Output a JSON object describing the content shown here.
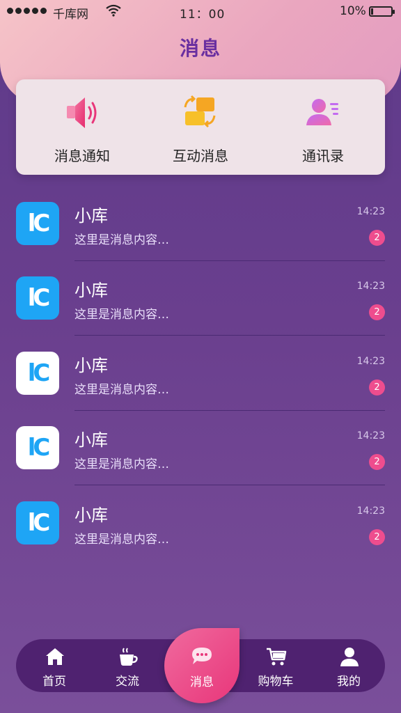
{
  "status_bar": {
    "carrier": "千库网",
    "time": "11：00",
    "battery": "10%",
    "battery_level": 0.1
  },
  "header": {
    "title": "消息"
  },
  "quick_actions": [
    {
      "label": "消息通知",
      "icon": "speaker-icon"
    },
    {
      "label": "互动消息",
      "icon": "interaction-icon"
    },
    {
      "label": "通讯录",
      "icon": "contacts-icon"
    }
  ],
  "messages": [
    {
      "name": "小库",
      "preview": "这里是消息内容…",
      "time": "14:23",
      "badge": "2",
      "avatar_style": "blue"
    },
    {
      "name": "小库",
      "preview": "这里是消息内容…",
      "time": "14:23",
      "badge": "2",
      "avatar_style": "blue"
    },
    {
      "name": "小库",
      "preview": "这里是消息内容…",
      "time": "14:23",
      "badge": "2",
      "avatar_style": "white"
    },
    {
      "name": "小库",
      "preview": "这里是消息内容…",
      "time": "14:23",
      "badge": "2",
      "avatar_style": "white"
    },
    {
      "name": "小库",
      "preview": "这里是消息内容…",
      "time": "14:23",
      "badge": "2",
      "avatar_style": "blue"
    }
  ],
  "tabbar": {
    "items": [
      {
        "label": "首页",
        "icon": "home-icon"
      },
      {
        "label": "交流",
        "icon": "coffee-icon"
      },
      {
        "label": "消息",
        "icon": "chat-bubble-icon",
        "active": true
      },
      {
        "label": "购物车",
        "icon": "cart-icon"
      },
      {
        "label": "我的",
        "icon": "user-icon"
      }
    ]
  },
  "colors": {
    "accent": "#ee4d8e",
    "title": "#6a2fa0",
    "avatar_blue": "#1ea5f5"
  }
}
